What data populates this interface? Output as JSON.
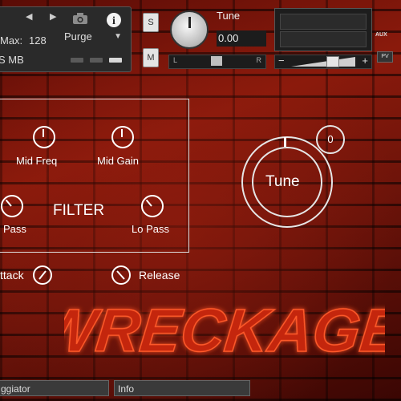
{
  "header": {
    "max_label": "Max:",
    "max_value": "128",
    "memory": "S MB",
    "purge_label": "Purge",
    "s_button": "S",
    "m_button": "M",
    "tune_label": "Tune",
    "tune_value": "0.00",
    "pan_left": "L",
    "pan_right": "R",
    "vol_minus": "−",
    "vol_plus": "+",
    "aux_label": "AUX",
    "pv_label": "PV"
  },
  "filter": {
    "title": "FILTER",
    "mid_freq": "Mid Freq",
    "mid_gain": "Mid Gain",
    "hi_pass": "Pass",
    "lo_pass": "Lo Pass"
  },
  "envelope": {
    "attack": "ttack",
    "release": "Release"
  },
  "tune_dial": {
    "label": "Tune",
    "value": "0"
  },
  "logo": {
    "text": "WRECKAGE"
  },
  "tabs": [
    {
      "label": "ggiator"
    },
    {
      "label": "Info"
    }
  ],
  "colors": {
    "accent": "#ffffff",
    "panel": "#2a2a2a",
    "brick": "#8a1a0c"
  }
}
